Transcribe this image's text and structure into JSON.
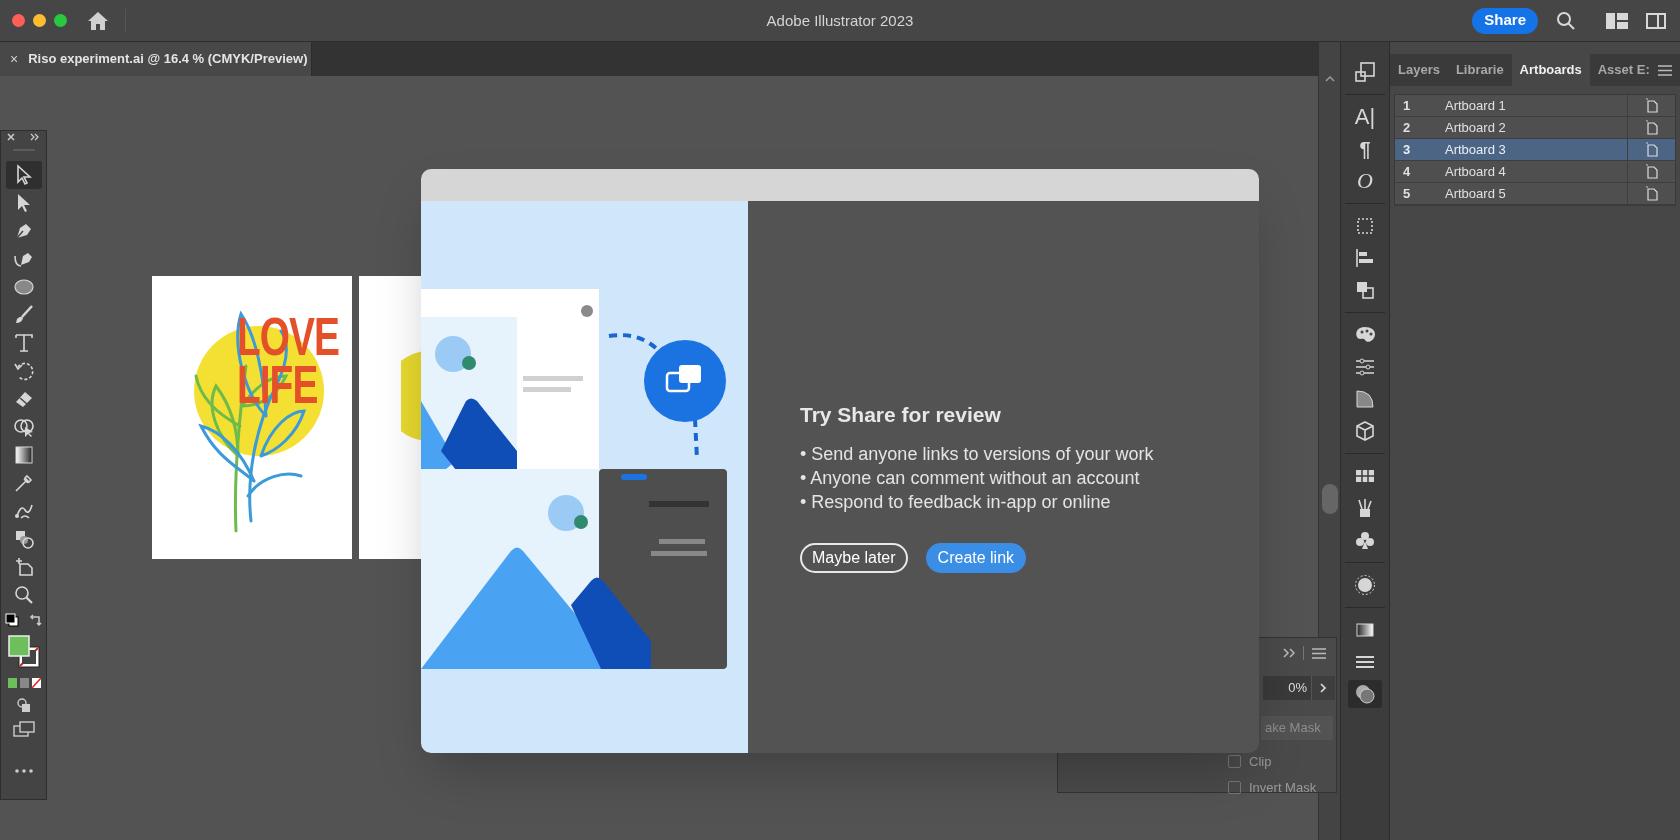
{
  "window": {
    "title": "Adobe Illustrator 2023"
  },
  "share_button": "Share",
  "document_tab": {
    "title": "Riso experiment.ai @ 16.4 % (CMYK/Preview)",
    "close": "×"
  },
  "artwork": {
    "lines": [
      "LOVE",
      "LIFE"
    ]
  },
  "dock_glyphs": [
    "A|",
    "¶",
    "O"
  ],
  "panel": {
    "tabs": [
      {
        "label": "Layers",
        "selected": false
      },
      {
        "label": "Librarie",
        "selected": false
      },
      {
        "label": "Artboards",
        "selected": true
      },
      {
        "label": "Asset E:",
        "selected": false
      }
    ],
    "rows": [
      {
        "number": "1",
        "name": "Artboard 1",
        "selected": false
      },
      {
        "number": "2",
        "name": "Artboard 2",
        "selected": false
      },
      {
        "number": "3",
        "name": "Artboard 3",
        "selected": true
      },
      {
        "number": "4",
        "name": "Artboard 4",
        "selected": false
      },
      {
        "number": "5",
        "name": "Artboard 5",
        "selected": false
      }
    ]
  },
  "transparency": {
    "opacity": "0%",
    "mask_button": "ake Mask",
    "options": [
      {
        "label": "Clip",
        "checked": false
      },
      {
        "label": "Invert Mask",
        "checked": false
      }
    ]
  },
  "dialog": {
    "title": "Try Share for review",
    "bullets": [
      "• Send anyone links to versions of your work",
      "• Anyone can comment without an account",
      "• Respond to feedback in-app or online"
    ],
    "buttons": [
      {
        "label": "Maybe later",
        "kind": "secondary"
      },
      {
        "label": "Create link",
        "kind": "primary"
      }
    ]
  }
}
